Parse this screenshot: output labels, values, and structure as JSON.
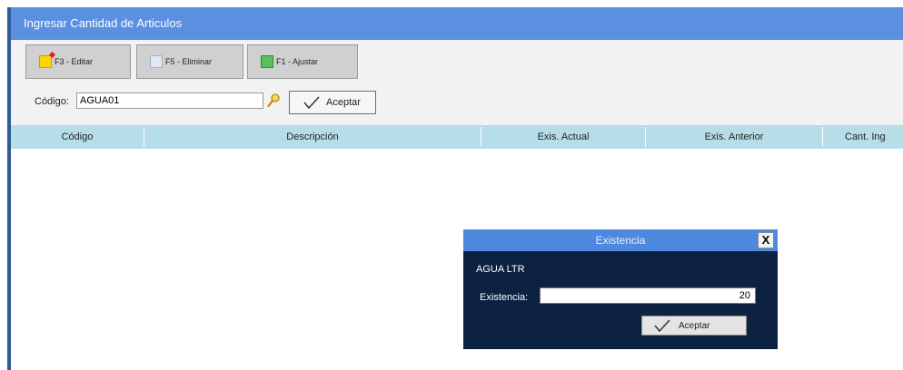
{
  "window": {
    "title": "Ingresar Cantidad de Articulos"
  },
  "toolbar": {
    "edit_label": "F3 - Editar",
    "delete_label": "F5 - Eliminar",
    "adjust_label": "F1 - Ajustar"
  },
  "search": {
    "label": "Código:",
    "value": "AGUA01",
    "accept_label": "Aceptar"
  },
  "grid": {
    "columns": [
      "Código",
      "Descripción",
      "Exis. Actual",
      "Exis. Anterior",
      "Cant. Ing"
    ]
  },
  "dialog": {
    "title": "Existencia",
    "close": "X",
    "item_name": "AGUA LTR",
    "field_label": "Existencia:",
    "field_value": "20",
    "accept_label": "Aceptar"
  },
  "colors": {
    "title_bar": "#5b8fe0",
    "grid_header": "#b7dde9",
    "dialog_background": "#0d2240"
  }
}
